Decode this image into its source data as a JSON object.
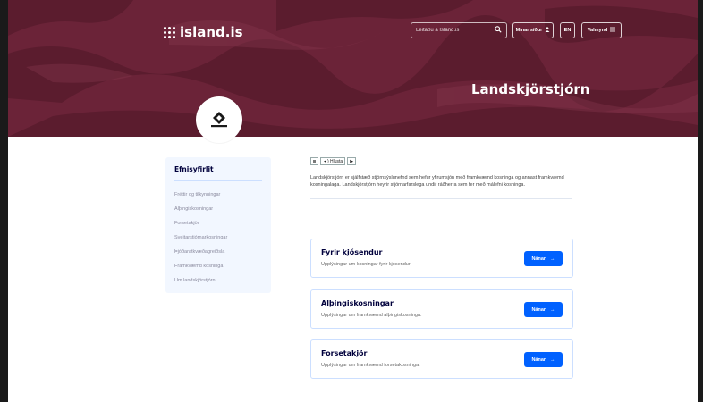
{
  "header": {
    "logo_text": "island.is",
    "search_placeholder": "Leitaðu á Ísland.is",
    "my_pages_label": "Mínar síður",
    "language_label": "EN",
    "menu_label": "Valmynd",
    "page_title": "Landskjörstjórn"
  },
  "sidebar": {
    "title": "Efnisyfirlit",
    "items": [
      {
        "label": "Fréttir og tilkynningar"
      },
      {
        "label": "Alþingiskosningar"
      },
      {
        "label": "Forsetakjör"
      },
      {
        "label": "Sveitarstjórnarkosningar"
      },
      {
        "label": "Þjóðaratkvæðagreiðsla"
      },
      {
        "label": "Framkvæmd kosninga"
      },
      {
        "label": "Um landskjörstjórn"
      }
    ]
  },
  "main": {
    "audio_label": "Hlusta",
    "intro": "Landskjörstjórn er sjálfstæð stjórnsýslunefnd sem hefur yfirumsjón með framkvæmd kosninga og annast framkvæmd kosningalaga. Landskjörstjórn heyrir stjórnarfarslega undir ráðherra sem fer með málefni kosninga.",
    "cards": [
      {
        "title": "Fyrir kjósendur",
        "description": "Upplýsingar um kosningar fyrir kjósendur",
        "button": "Nánar"
      },
      {
        "title": "Alþingiskosningar",
        "description": "Upplýsingar um framkvæmd alþingiskosninga.",
        "button": "Nánar"
      },
      {
        "title": "Forsetakjör",
        "description": "Upplýsingar um framkvæmd forsetakosninga.",
        "button": "Nánar"
      }
    ]
  },
  "colors": {
    "hero_bg": "#6b2338",
    "accent": "#0061ff",
    "sidebar_bg": "#f2f7ff",
    "title_text": "#00003c"
  },
  "icons": {
    "search": "search-icon",
    "user": "user-icon",
    "menu": "menu-icon",
    "arrow": "arrow-right-icon",
    "org": "landskjorstjorn-logo-icon"
  }
}
